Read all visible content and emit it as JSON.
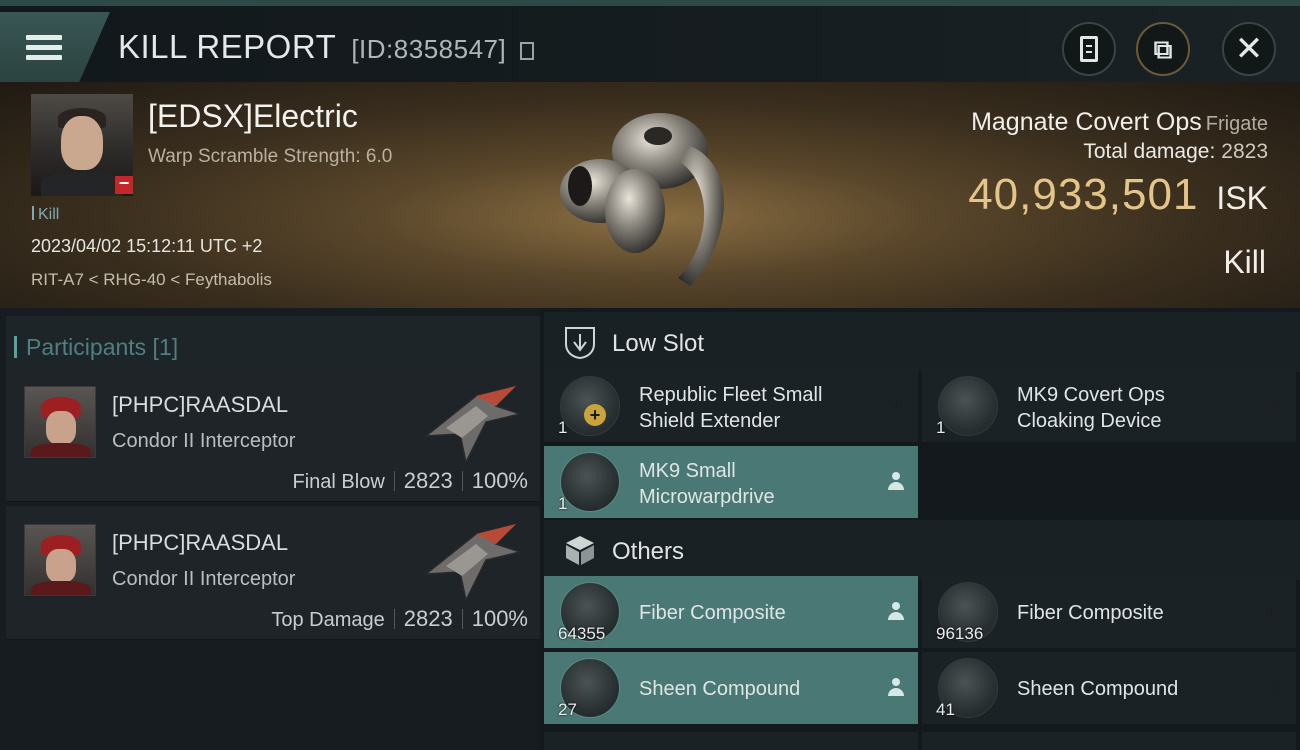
{
  "header": {
    "title": "KILL REPORT",
    "report_id": "[ID:8358547]",
    "menu_icon": "hamburger-menu-icon",
    "clipboard_icon": "clipboard-icon",
    "share_icon": "share-icon",
    "close_icon": "close-icon"
  },
  "victim": {
    "name": "[EDSX]Electric",
    "warp_scramble": "Warp Scramble Strength: 6.0",
    "tag": "Kill",
    "datetime": "2023/04/02 15:12:11 UTC +2",
    "location": "RIT-A7 < RHG-40 < Feythabolis",
    "ship_name": "Magnate Covert Ops",
    "ship_class": "Frigate",
    "total_damage_label": "Total damage:",
    "total_damage_value": "2823",
    "isk_value": "40,933,501",
    "isk_unit": "ISK",
    "result": "Kill"
  },
  "participants": {
    "label": "Participants [1]",
    "rows": [
      {
        "name": "[PHPC]RAASDAL",
        "ship": "Condor II Interceptor",
        "role": "Final Blow",
        "damage": "2823",
        "percent": "100%"
      },
      {
        "name": "[PHPC]RAASDAL",
        "ship": "Condor II Interceptor",
        "role": "Top Damage",
        "damage": "2823",
        "percent": "100%"
      }
    ]
  },
  "sections": {
    "low_slot": {
      "label": "Low Slot",
      "icon": "low-slot-icon",
      "items": [
        {
          "name": "Republic Fleet Small Shield Extender",
          "qty": "1",
          "status": "destroyed"
        },
        {
          "name": "MK9 Covert Ops Cloaking Device",
          "qty": "1",
          "status": "destroyed"
        },
        {
          "name": "MK9 Small Microwarpdrive",
          "qty": "1",
          "status": "dropped"
        }
      ]
    },
    "others": {
      "label": "Others",
      "icon": "cargo-box-icon",
      "items": [
        {
          "name": "Fiber Composite",
          "qty": "64355",
          "status": "dropped"
        },
        {
          "name": "Fiber Composite",
          "qty": "96136",
          "status": "destroyed"
        },
        {
          "name": "Sheen Compound",
          "qty": "27",
          "status": "dropped"
        },
        {
          "name": "Sheen Compound",
          "qty": "41",
          "status": "destroyed"
        }
      ]
    }
  },
  "colors": {
    "dropped_bg": "#4a7874",
    "isk": "#e3c489",
    "accent_teal": "#57a3a0",
    "banner_gold": "#8a6e42"
  }
}
